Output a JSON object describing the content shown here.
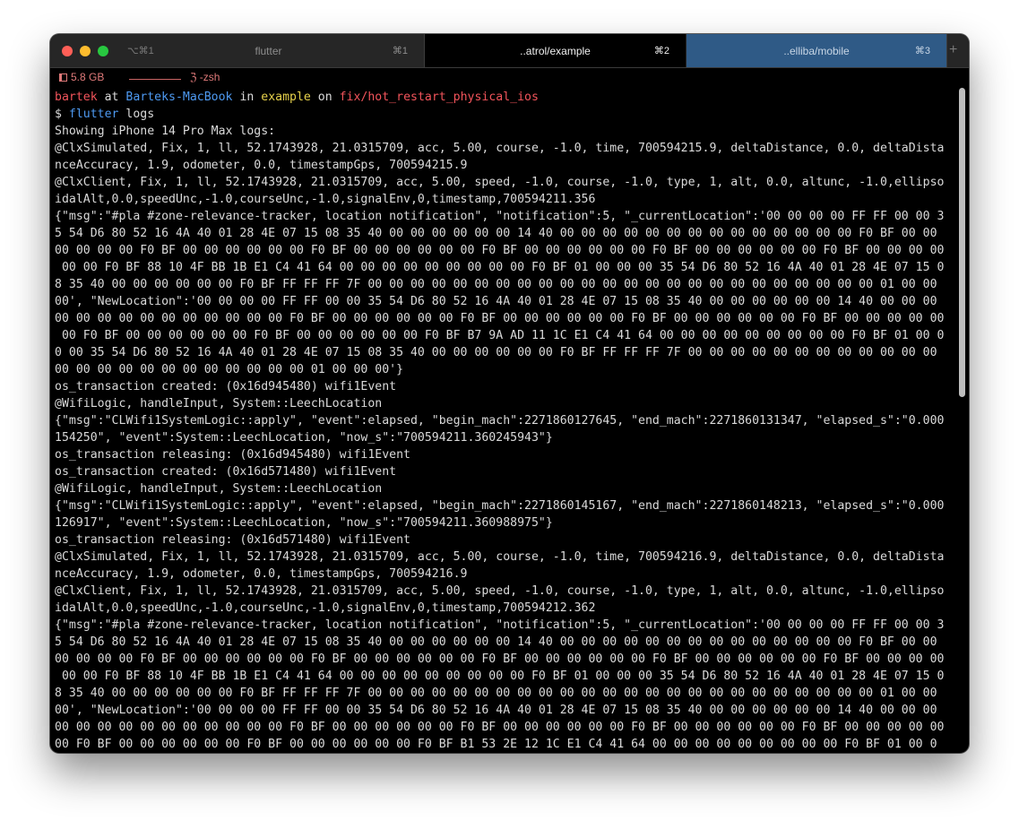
{
  "tabs": [
    {
      "lead": "⌥⌘1",
      "title": "flutter",
      "shortcut": "⌘1"
    },
    {
      "title": "..atrol/example",
      "shortcut": "⌘2"
    },
    {
      "title": "..elliba/mobile",
      "shortcut": "⌘3"
    }
  ],
  "add_tab_icon": "+",
  "status": {
    "memory": "5.8 GB",
    "shell": "ℨ -zsh"
  },
  "prompt": {
    "user": "bartek",
    "at": " at ",
    "host": "Barteks-MacBook",
    "in": " in ",
    "dir": "example",
    "on": " on ",
    "branch": "fix/hot_restart_physical_ios",
    "symbol": "$ ",
    "cmd": "flutter",
    "args": " logs"
  },
  "output": [
    "Showing iPhone 14 Pro Max logs:",
    "@ClxSimulated, Fix, 1, ll, 52.1743928, 21.0315709, acc, 5.00, course, -1.0, time, 700594215.9, deltaDistance, 0.0, deltaDista",
    "nceAccuracy, 1.9, odometer, 0.0, timestampGps, 700594215.9",
    "@ClxClient, Fix, 1, ll, 52.1743928, 21.0315709, acc, 5.00, speed, -1.0, course, -1.0, type, 1, alt, 0.0, altunc, -1.0,ellipso",
    "idalAlt,0.0,speedUnc,-1.0,courseUnc,-1.0,signalEnv,0,timestamp,700594211.356",
    "{\"msg\":\"#pla #zone-relevance-tracker, location notification\", \"notification\":5, \"_currentLocation\":'00 00 00 00 FF FF 00 00 3",
    "5 54 D6 80 52 16 4A 40 01 28 4E 07 15 08 35 40 00 00 00 00 00 00 14 40 00 00 00 00 00 00 00 00 00 00 00 00 00 00 F0 BF 00 00",
    "00 00 00 00 F0 BF 00 00 00 00 00 00 F0 BF 00 00 00 00 00 00 F0 BF 00 00 00 00 00 00 F0 BF 00 00 00 00 00 00 F0 BF 00 00 00 00",
    " 00 00 F0 BF 88 10 4F BB 1B E1 C4 41 64 00 00 00 00 00 00 00 00 00 F0 BF 01 00 00 00 35 54 D6 80 52 16 4A 40 01 28 4E 07 15 0",
    "8 35 40 00 00 00 00 00 00 F0 BF FF FF FF 7F 00 00 00 00 00 00 00 00 00 00 00 00 00 00 00 00 00 00 00 00 00 00 00 00 01 00 00",
    "00', \"NewLocation\":'00 00 00 00 FF FF 00 00 35 54 D6 80 52 16 4A 40 01 28 4E 07 15 08 35 40 00 00 00 00 00 00 14 40 00 00 00",
    "00 00 00 00 00 00 00 00 00 00 00 F0 BF 00 00 00 00 00 00 F0 BF 00 00 00 00 00 00 F0 BF 00 00 00 00 00 00 F0 BF 00 00 00 00 00",
    " 00 F0 BF 00 00 00 00 00 00 F0 BF 00 00 00 00 00 00 F0 BF B7 9A AD 11 1C E1 C4 41 64 00 00 00 00 00 00 00 00 00 F0 BF 01 00 0",
    "0 00 35 54 D6 80 52 16 4A 40 01 28 4E 07 15 08 35 40 00 00 00 00 00 00 F0 BF FF FF FF 7F 00 00 00 00 00 00 00 00 00 00 00 00",
    "00 00 00 00 00 00 00 00 00 00 00 00 01 00 00 00'}",
    "os_transaction created: (0x16d945480) wifi1Event",
    "@WifiLogic, handleInput, System::LeechLocation",
    "{\"msg\":\"CLWifi1SystemLogic::apply\", \"event\":elapsed, \"begin_mach\":2271860127645, \"end_mach\":2271860131347, \"elapsed_s\":\"0.000",
    "154250\", \"event\":System::LeechLocation, \"now_s\":\"700594211.360245943\"}",
    "os_transaction releasing: (0x16d945480) wifi1Event",
    "os_transaction created: (0x16d571480) wifi1Event",
    "@WifiLogic, handleInput, System::LeechLocation",
    "{\"msg\":\"CLWifi1SystemLogic::apply\", \"event\":elapsed, \"begin_mach\":2271860145167, \"end_mach\":2271860148213, \"elapsed_s\":\"0.000",
    "126917\", \"event\":System::LeechLocation, \"now_s\":\"700594211.360988975\"}",
    "os_transaction releasing: (0x16d571480) wifi1Event",
    "@ClxSimulated, Fix, 1, ll, 52.1743928, 21.0315709, acc, 5.00, course, -1.0, time, 700594216.9, deltaDistance, 0.0, deltaDista",
    "nceAccuracy, 1.9, odometer, 0.0, timestampGps, 700594216.9",
    "@ClxClient, Fix, 1, ll, 52.1743928, 21.0315709, acc, 5.00, speed, -1.0, course, -1.0, type, 1, alt, 0.0, altunc, -1.0,ellipso",
    "idalAlt,0.0,speedUnc,-1.0,courseUnc,-1.0,signalEnv,0,timestamp,700594212.362",
    "{\"msg\":\"#pla #zone-relevance-tracker, location notification\", \"notification\":5, \"_currentLocation\":'00 00 00 00 FF FF 00 00 3",
    "5 54 D6 80 52 16 4A 40 01 28 4E 07 15 08 35 40 00 00 00 00 00 00 14 40 00 00 00 00 00 00 00 00 00 00 00 00 00 00 F0 BF 00 00",
    "00 00 00 00 F0 BF 00 00 00 00 00 00 F0 BF 00 00 00 00 00 00 F0 BF 00 00 00 00 00 00 F0 BF 00 00 00 00 00 00 F0 BF 00 00 00 00",
    " 00 00 F0 BF 88 10 4F BB 1B E1 C4 41 64 00 00 00 00 00 00 00 00 00 F0 BF 01 00 00 00 35 54 D6 80 52 16 4A 40 01 28 4E 07 15 0",
    "8 35 40 00 00 00 00 00 00 F0 BF FF FF FF 7F 00 00 00 00 00 00 00 00 00 00 00 00 00 00 00 00 00 00 00 00 00 00 00 00 01 00 00",
    "00', \"NewLocation\":'00 00 00 00 FF FF 00 00 35 54 D6 80 52 16 4A 40 01 28 4E 07 15 08 35 40 00 00 00 00 00 00 14 40 00 00 00",
    "00 00 00 00 00 00 00 00 00 00 00 F0 BF 00 00 00 00 00 00 F0 BF 00 00 00 00 00 00 F0 BF 00 00 00 00 00 00 F0 BF 00 00 00 00 00",
    "00 F0 BF 00 00 00 00 00 00 F0 BF 00 00 00 00 00 00 F0 BF B1 53 2E 12 1C E1 C4 41 64 00 00 00 00 00 00 00 00 00 F0 BF 01 00 0"
  ],
  "colors": {
    "red": "#f2545b",
    "blue": "#4e9af2",
    "yellow": "#e6d14b",
    "active_tab_blue": "#2f5a86"
  }
}
